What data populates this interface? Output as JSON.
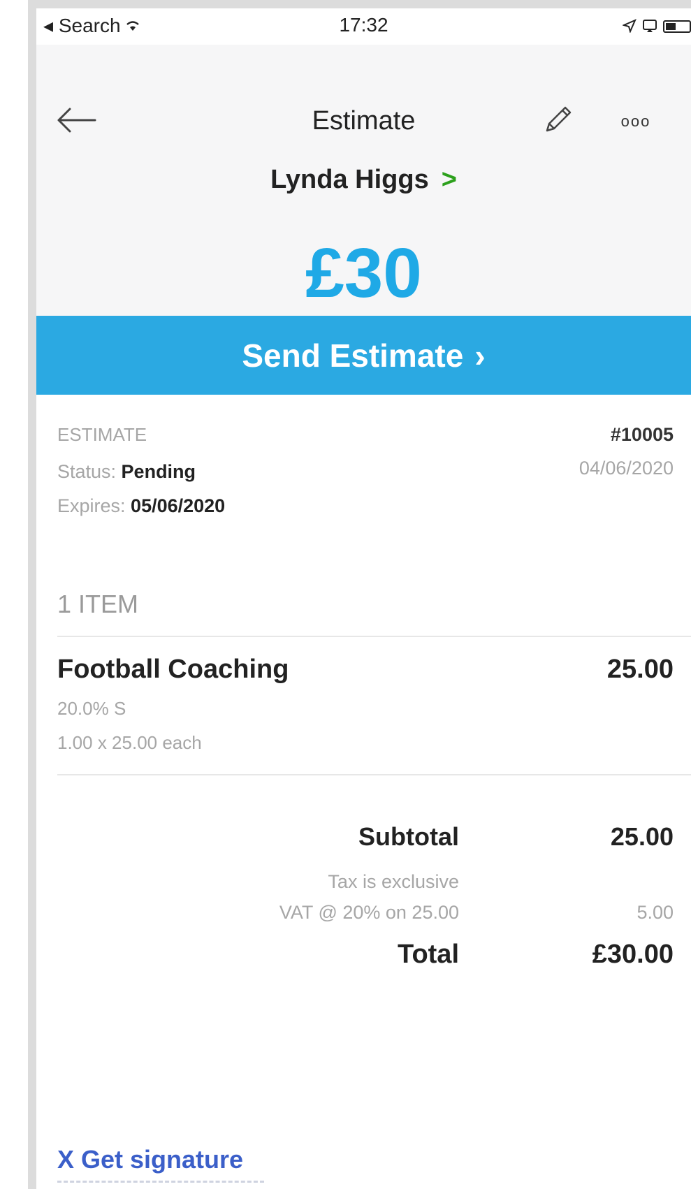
{
  "status_bar": {
    "back_app": "◂ Search",
    "time": "17:32"
  },
  "header": {
    "title": "Estimate",
    "customer_name": "Lynda Higgs",
    "customer_chevron": ">",
    "amount": "£30",
    "more_label": "ooo"
  },
  "send_button": {
    "label": "Send Estimate",
    "chevron": "›"
  },
  "estimate_info": {
    "section_label": "ESTIMATE",
    "status_prefix": "Status: ",
    "status_value": "Pending",
    "expires_prefix": "Expires: ",
    "expires_value": "05/06/2020",
    "number": "#10005",
    "date": "04/06/2020"
  },
  "items": {
    "count_label": "1 ITEM",
    "list": [
      {
        "name": "Football Coaching",
        "amount": "25.00",
        "tax": "20.0% S",
        "qty_line": "1.00 x 25.00 each"
      }
    ]
  },
  "totals": {
    "subtotal_label": "Subtotal",
    "subtotal_value": "25.00",
    "tax_note": "Tax is exclusive",
    "vat_label": "VAT @ 20% on 25.00",
    "vat_value": "5.00",
    "total_label": "Total",
    "total_value": "£30.00"
  },
  "signature": {
    "label": "X Get signature"
  },
  "colors": {
    "accent_blue": "#2ba9e2",
    "amount_blue": "#1fa9e6",
    "chevron_green": "#2ca01c",
    "signature_blue": "#3b5fc9"
  },
  "icons": {
    "back": "arrow-left-icon",
    "edit": "pencil-icon",
    "more": "more-options-icon",
    "wifi": "wifi-icon",
    "location": "location-arrow-icon",
    "screen_mirroring": "screen-mirroring-icon",
    "battery": "battery-icon"
  }
}
